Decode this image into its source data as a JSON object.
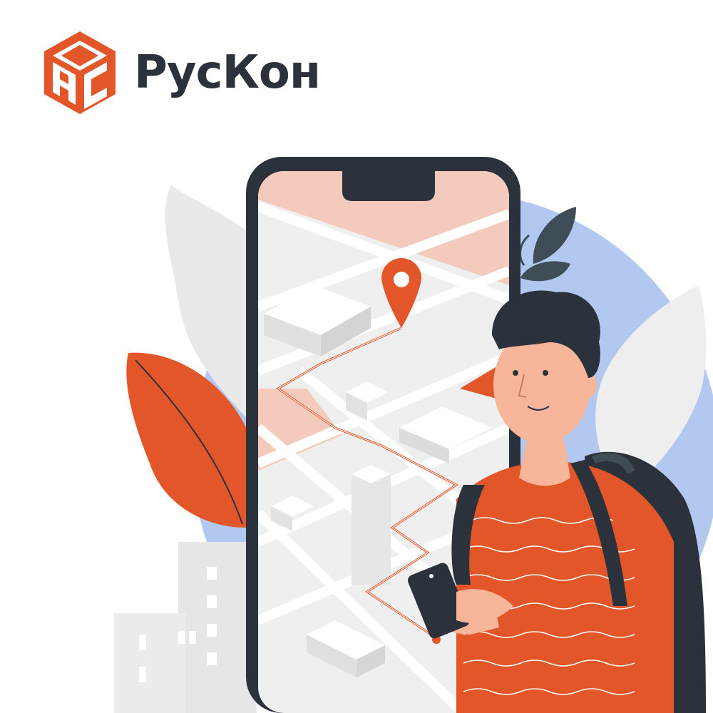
{
  "brand": {
    "name": "РусКон",
    "logo_icon": "cube-logo-icon",
    "logo_letters": "РС"
  },
  "colors": {
    "accent_orange": "#e2562a",
    "dark": "#2b323b",
    "blue_backdrop": "#b2c8f0",
    "map_pink": "#f3cabc",
    "map_gray": "#efefef",
    "skin": "#f7b59a"
  },
  "illustration": {
    "subject": "person-with-phone-map-illustration",
    "pin_icon": "location-pin-icon"
  }
}
